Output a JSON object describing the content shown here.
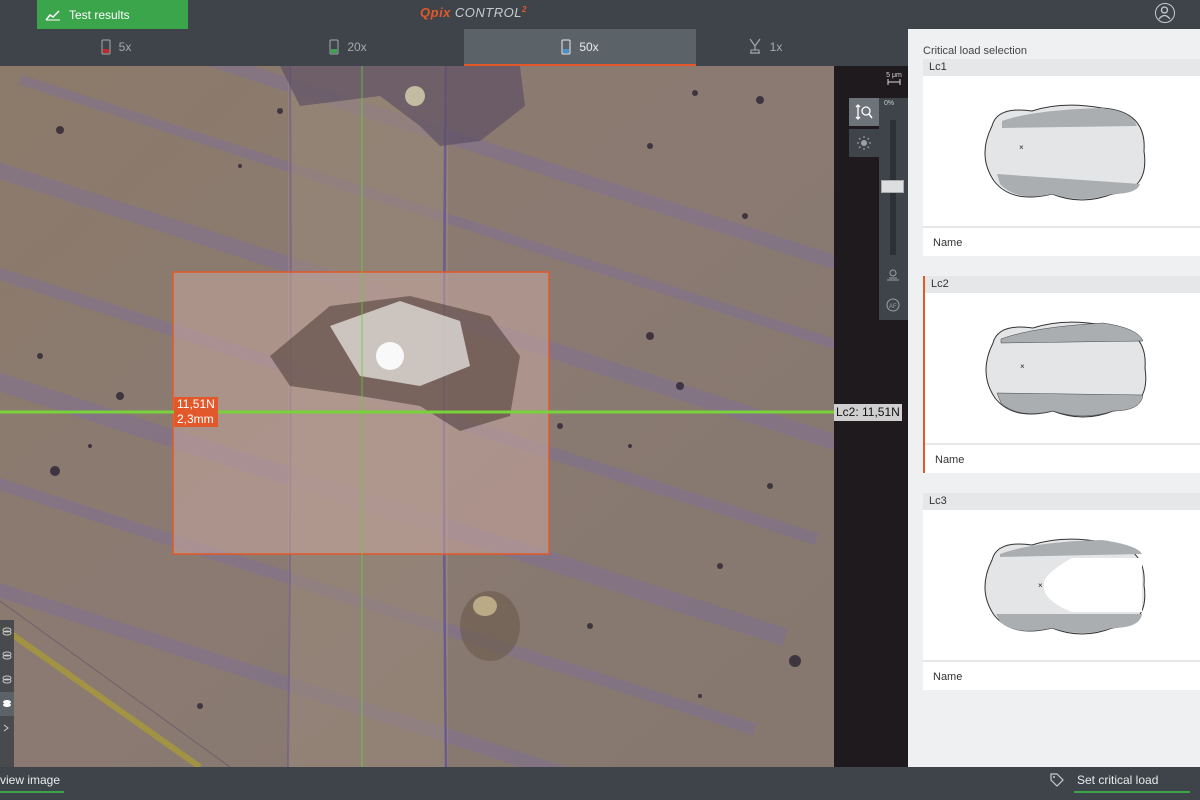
{
  "header": {
    "test_results_label": "Test results",
    "logo_q": "Q",
    "logo_pix": "pix",
    "logo_control": "CONTROL",
    "logo_sup": "2",
    "accent": "#3aa54a",
    "brand": "#e2582a"
  },
  "tabs": [
    {
      "label": "5x",
      "icon": "objective-red-icon",
      "active": false
    },
    {
      "label": "20x",
      "icon": "objective-green-icon",
      "active": false
    },
    {
      "label": "50x",
      "icon": "objective-blue-icon",
      "active": true
    },
    {
      "label": "1x",
      "icon": "indenter-icon",
      "active": false
    }
  ],
  "viewer": {
    "scale_value": "5 μm",
    "slider_percent": "0%",
    "measurement_load": "11,51N",
    "measurement_distance": "2,3mm",
    "line_label": "Lc2: 11,51N"
  },
  "sidebar": {
    "title": "Critical load selection",
    "cards": [
      {
        "header": "Lc1",
        "name": "Name",
        "selected": false
      },
      {
        "header": "Lc2",
        "name": "Name",
        "selected": true
      },
      {
        "header": "Lc3",
        "name": "Name",
        "selected": false
      }
    ]
  },
  "footer": {
    "view_image_label": "view image",
    "set_critical_load_label": "Set critical load"
  }
}
